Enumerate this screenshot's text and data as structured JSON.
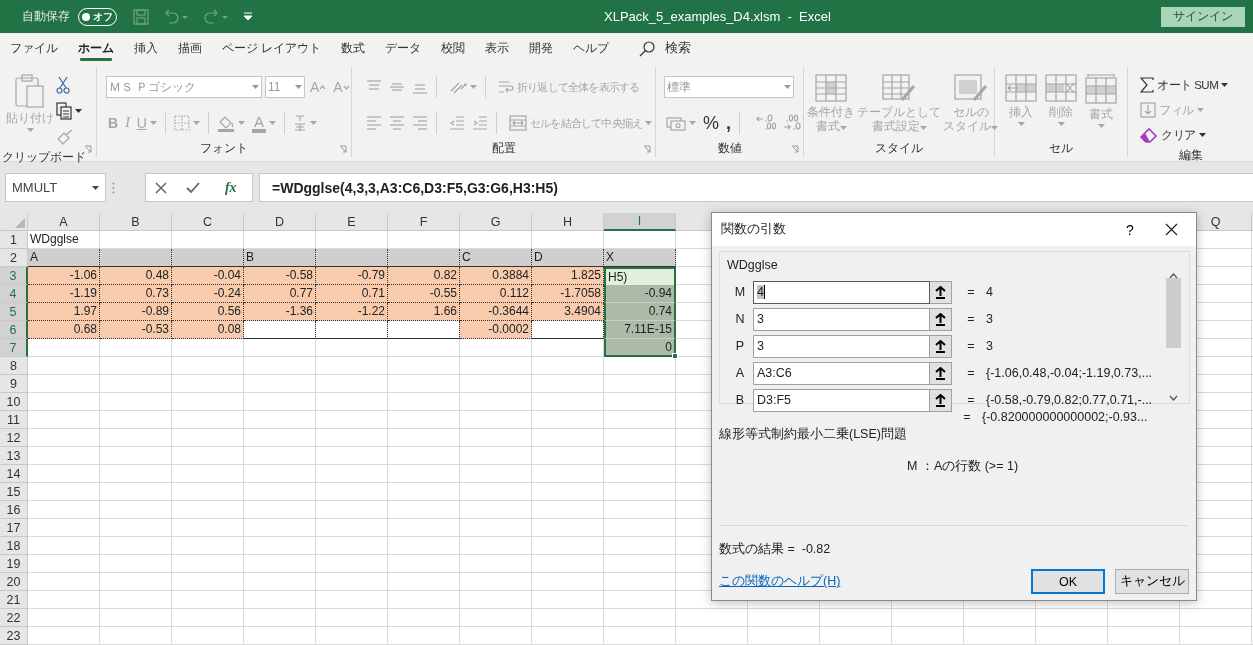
{
  "title_bar": {
    "autosave_label": "自動保存",
    "autosave": {
      "on": false,
      "label": "オフ"
    },
    "title": "XLPack_5_examples_D4.xlsm  -  Excel",
    "sign_in": "サインイン"
  },
  "menu_tabs": [
    {
      "label": "ファイル",
      "selected": false
    },
    {
      "label": "ホーム",
      "selected": true
    },
    {
      "label": "挿入",
      "selected": false
    },
    {
      "label": "描画",
      "selected": false
    },
    {
      "label": "ページ レイアウト",
      "selected": false
    },
    {
      "label": "数式",
      "selected": false
    },
    {
      "label": "データ",
      "selected": false
    },
    {
      "label": "校閲",
      "selected": false
    },
    {
      "label": "表示",
      "selected": false
    },
    {
      "label": "開発",
      "selected": false
    },
    {
      "label": "ヘルプ",
      "selected": false
    }
  ],
  "search": {
    "label": "検索"
  },
  "ribbon": {
    "groups": [
      {
        "kind": "clipboard",
        "label": "クリップボード",
        "launcher": true,
        "large": [
          {
            "kind": "paste",
            "label": "貼り付け",
            "caret": true,
            "disabled": true
          }
        ],
        "lines": [
          {
            "controls": [
              {
                "kind": "cut",
                "disabled": false
              }
            ]
          },
          {
            "controls": [
              {
                "kind": "copy",
                "caret": true,
                "disabled": false
              }
            ]
          },
          {
            "controls": [
              {
                "kind": "format-painter",
                "disabled": true
              }
            ]
          }
        ]
      },
      {
        "kind": "font",
        "label": "フォント",
        "launcher": true,
        "lines": [
          {
            "controls": [
              {
                "kind": "font-name",
                "label": "ＭＳ Ｐゴシック",
                "caret": true,
                "disabled": true
              },
              {
                "kind": "font-size",
                "label": "11",
                "caret": true,
                "disabled": true
              },
              {
                "kind": "grow-font",
                "label": "A",
                "disabled": true
              },
              {
                "kind": "shrink-font",
                "label": "A",
                "disabled": true
              }
            ]
          },
          {
            "controls": [
              {
                "kind": "bold",
                "label": "B",
                "disabled": true
              },
              {
                "kind": "italic",
                "label": "I",
                "disabled": true
              },
              {
                "kind": "underline",
                "label": "U",
                "caret": true,
                "disabled": true
              },
              {
                "kind": "borders",
                "caret": true,
                "disabled": true
              },
              {
                "kind": "fill-color",
                "caret": true,
                "disabled": true
              },
              {
                "kind": "font-color",
                "label": "A",
                "caret": true,
                "disabled": true
              },
              {
                "kind": "phonetic",
                "caret": true,
                "disabled": true
              }
            ]
          }
        ]
      },
      {
        "kind": "alignment",
        "label": "配置",
        "launcher": true,
        "lines": [
          {
            "controls": [
              {
                "kind": "align-top",
                "disabled": true
              },
              {
                "kind": "align-middle",
                "disabled": true
              },
              {
                "kind": "align-bottom",
                "disabled": true
              },
              {
                "kind": "orientation",
                "caret": true,
                "disabled": true
              },
              {
                "kind": "wrap-text",
                "label": "折り返して全体を表示する",
                "disabled": true
              }
            ]
          },
          {
            "controls": [
              {
                "kind": "align-left",
                "disabled": true
              },
              {
                "kind": "align-center",
                "disabled": true
              },
              {
                "kind": "align-right",
                "disabled": true
              },
              {
                "kind": "decrease-indent",
                "disabled": true
              },
              {
                "kind": "increase-indent",
                "disabled": true
              },
              {
                "kind": "merge-center",
                "label": "セルを結合して中央揃え",
                "caret": true,
                "disabled": true
              }
            ]
          }
        ]
      },
      {
        "kind": "number",
        "label": "数値",
        "launcher": true,
        "lines": [
          {
            "controls": [
              {
                "kind": "number-format",
                "label": "標準",
                "caret": true,
                "disabled": true
              }
            ]
          },
          {
            "controls": [
              {
                "kind": "accounting",
                "caret": true,
                "disabled": true
              },
              {
                "kind": "percent",
                "label": "%",
                "disabled": false
              },
              {
                "kind": "comma",
                "label": ",",
                "disabled": false
              },
              {
                "kind": "increase-decimal",
                "disabled": true
              },
              {
                "kind": "decrease-decimal",
                "disabled": true
              }
            ]
          }
        ]
      },
      {
        "kind": "styles",
        "label": "スタイル",
        "large": [
          {
            "kind": "conditional-format",
            "lines": [
              "条件付き",
              "書式"
            ],
            "caret": true,
            "disabled": true
          },
          {
            "kind": "format-table",
            "lines": [
              "テーブルとして",
              "書式設定"
            ],
            "caret": true,
            "disabled": true
          },
          {
            "kind": "cell-styles",
            "lines": [
              "セルの",
              "スタイル"
            ],
            "caret": true,
            "disabled": true
          }
        ]
      },
      {
        "kind": "cells",
        "label": "セル",
        "large": [
          {
            "kind": "insert",
            "label": "挿入",
            "caret": true,
            "disabled": true
          },
          {
            "kind": "delete",
            "label": "削除",
            "caret": true,
            "disabled": true
          },
          {
            "kind": "format",
            "label": "書式",
            "caret": true,
            "disabled": true
          }
        ]
      },
      {
        "kind": "editing",
        "label": "編集",
        "lines": [
          {
            "controls": [
              {
                "kind": "autosum",
                "label": "オート SUM",
                "caret": true,
                "disabled": false
              }
            ]
          },
          {
            "controls": [
              {
                "kind": "fill",
                "label": "フィル",
                "caret": true,
                "disabled": true
              }
            ]
          },
          {
            "controls": [
              {
                "kind": "clear",
                "label": "クリア",
                "caret": true,
                "disabled": false
              }
            ]
          }
        ]
      }
    ]
  },
  "formula_bar": {
    "name_box": "MMULT",
    "fx": "fx",
    "formula": "=WDgglse(4,3,3,A3:C6,D3:F5,G3:G6,H3:H5)"
  },
  "sheet": {
    "columns": [
      {
        "label": "A",
        "selected": false
      },
      {
        "label": "B",
        "selected": false
      },
      {
        "label": "C",
        "selected": false
      },
      {
        "label": "D",
        "selected": false
      },
      {
        "label": "E",
        "selected": false
      },
      {
        "label": "F",
        "selected": false
      },
      {
        "label": "G",
        "selected": false
      },
      {
        "label": "H",
        "selected": false
      },
      {
        "label": "I",
        "selected": true
      },
      {
        "label": "Q",
        "selected": false
      }
    ],
    "rows": [
      {
        "header": "1",
        "selected": false,
        "cells": [
          {
            "kind": "plain",
            "text": "WDgglse"
          }
        ]
      },
      {
        "header": "2",
        "selected": false,
        "cells": [
          {
            "kind": "header",
            "text": "A"
          },
          {
            "kind": "header"
          },
          {
            "kind": "header"
          },
          {
            "kind": "header",
            "text": "B"
          },
          {
            "kind": "header"
          },
          {
            "kind": "header"
          },
          {
            "kind": "header",
            "text": "C"
          },
          {
            "kind": "header",
            "text": "D"
          },
          {
            "kind": "header",
            "text": "X"
          }
        ]
      },
      {
        "header": "3",
        "selected": true,
        "cells": [
          {
            "kind": "input",
            "text": "-1.06"
          },
          {
            "kind": "input",
            "text": "0.48"
          },
          {
            "kind": "input",
            "text": "-0.04"
          },
          {
            "kind": "input",
            "text": "-0.58"
          },
          {
            "kind": "input",
            "text": "-0.79"
          },
          {
            "kind": "input",
            "text": "0.82"
          },
          {
            "kind": "input",
            "text": "0.3884"
          },
          {
            "kind": "input",
            "text": "1.825"
          },
          {
            "kind": "editing",
            "text": "H5)"
          }
        ]
      },
      {
        "header": "4",
        "selected": true,
        "cells": [
          {
            "kind": "input",
            "text": "-1.19"
          },
          {
            "kind": "input",
            "text": "0.73"
          },
          {
            "kind": "input",
            "text": "-0.24"
          },
          {
            "kind": "input",
            "text": "0.77"
          },
          {
            "kind": "input",
            "text": "0.71"
          },
          {
            "kind": "input",
            "text": "-0.55"
          },
          {
            "kind": "input",
            "text": "0.112"
          },
          {
            "kind": "input",
            "text": "-1.7058"
          },
          {
            "kind": "output",
            "text": "-0.94"
          }
        ]
      },
      {
        "header": "5",
        "selected": true,
        "cells": [
          {
            "kind": "input",
            "text": "1.97"
          },
          {
            "kind": "input",
            "text": "-0.89"
          },
          {
            "kind": "input",
            "text": "0.56"
          },
          {
            "kind": "input",
            "text": "-1.36"
          },
          {
            "kind": "input",
            "text": "-1.22"
          },
          {
            "kind": "input",
            "text": "1.66"
          },
          {
            "kind": "input",
            "text": "-0.3644"
          },
          {
            "kind": "input",
            "text": "3.4904"
          },
          {
            "kind": "output",
            "text": "0.74"
          }
        ]
      },
      {
        "header": "6",
        "selected": true,
        "cells": [
          {
            "kind": "input",
            "text": "0.68"
          },
          {
            "kind": "input",
            "text": "-0.53"
          },
          {
            "kind": "input",
            "text": "0.08"
          },
          {
            "kind": "framed"
          },
          {
            "kind": "framed"
          },
          {
            "kind": "framed"
          },
          {
            "kind": "input",
            "text": "-0.0002"
          },
          {
            "kind": "framed"
          },
          {
            "kind": "output",
            "text": "7.11E-15"
          }
        ]
      },
      {
        "header": "7",
        "selected": true,
        "cells": [
          {
            "kind": "plain"
          },
          {
            "kind": "plain"
          },
          {
            "kind": "plain"
          },
          {
            "kind": "plain"
          },
          {
            "kind": "plain"
          },
          {
            "kind": "plain"
          },
          {
            "kind": "plain"
          },
          {
            "kind": "plain"
          },
          {
            "kind": "output",
            "text": "0"
          }
        ]
      },
      {
        "header": "8",
        "selected": false
      },
      {
        "header": "9",
        "selected": false
      },
      {
        "header": "10",
        "selected": false
      },
      {
        "header": "11",
        "selected": false
      },
      {
        "header": "12",
        "selected": false
      },
      {
        "header": "13",
        "selected": false
      },
      {
        "header": "14",
        "selected": false
      },
      {
        "header": "15",
        "selected": false
      },
      {
        "header": "16",
        "selected": false
      },
      {
        "header": "17",
        "selected": false
      },
      {
        "header": "18",
        "selected": false
      },
      {
        "header": "19",
        "selected": false
      },
      {
        "header": "20",
        "selected": false
      },
      {
        "header": "21",
        "selected": false
      },
      {
        "header": "22",
        "selected": false
      },
      {
        "header": "23",
        "selected": false
      }
    ]
  },
  "dialog": {
    "title": "関数の引数",
    "help_button": "?",
    "function_name": "WDgglse",
    "arguments": [
      {
        "name": "M",
        "value": "4",
        "equals": "=",
        "result": "4",
        "focused": true
      },
      {
        "name": "N",
        "value": "3",
        "equals": "=",
        "result": "3",
        "focused": false
      },
      {
        "name": "P",
        "value": "3",
        "equals": "=",
        "result": "3",
        "focused": false
      },
      {
        "name": "A",
        "value": "A3:C6",
        "equals": "=",
        "result": "{-1.06,0.48,-0.04;-1.19,0.73,...",
        "focused": false
      },
      {
        "name": "B",
        "value": "D3:F5",
        "equals": "=",
        "result": "{-0.58,-0.79,0.82;0.77,0.71,-...",
        "focused": false
      }
    ],
    "formula_result": {
      "equals": "=",
      "value": "{-0.820000000000002;-0.93..."
    },
    "description": "線形等式制約最小二乗(LSE)問題",
    "argument_help": "M ：Aの行数 (>= 1)",
    "result_line": "数式の結果 =  -0.82",
    "help_link": "この関数のヘルプ(H)",
    "buttons": [
      {
        "label": "OK",
        "default": true
      },
      {
        "label": "キャンセル",
        "default": false
      }
    ]
  }
}
